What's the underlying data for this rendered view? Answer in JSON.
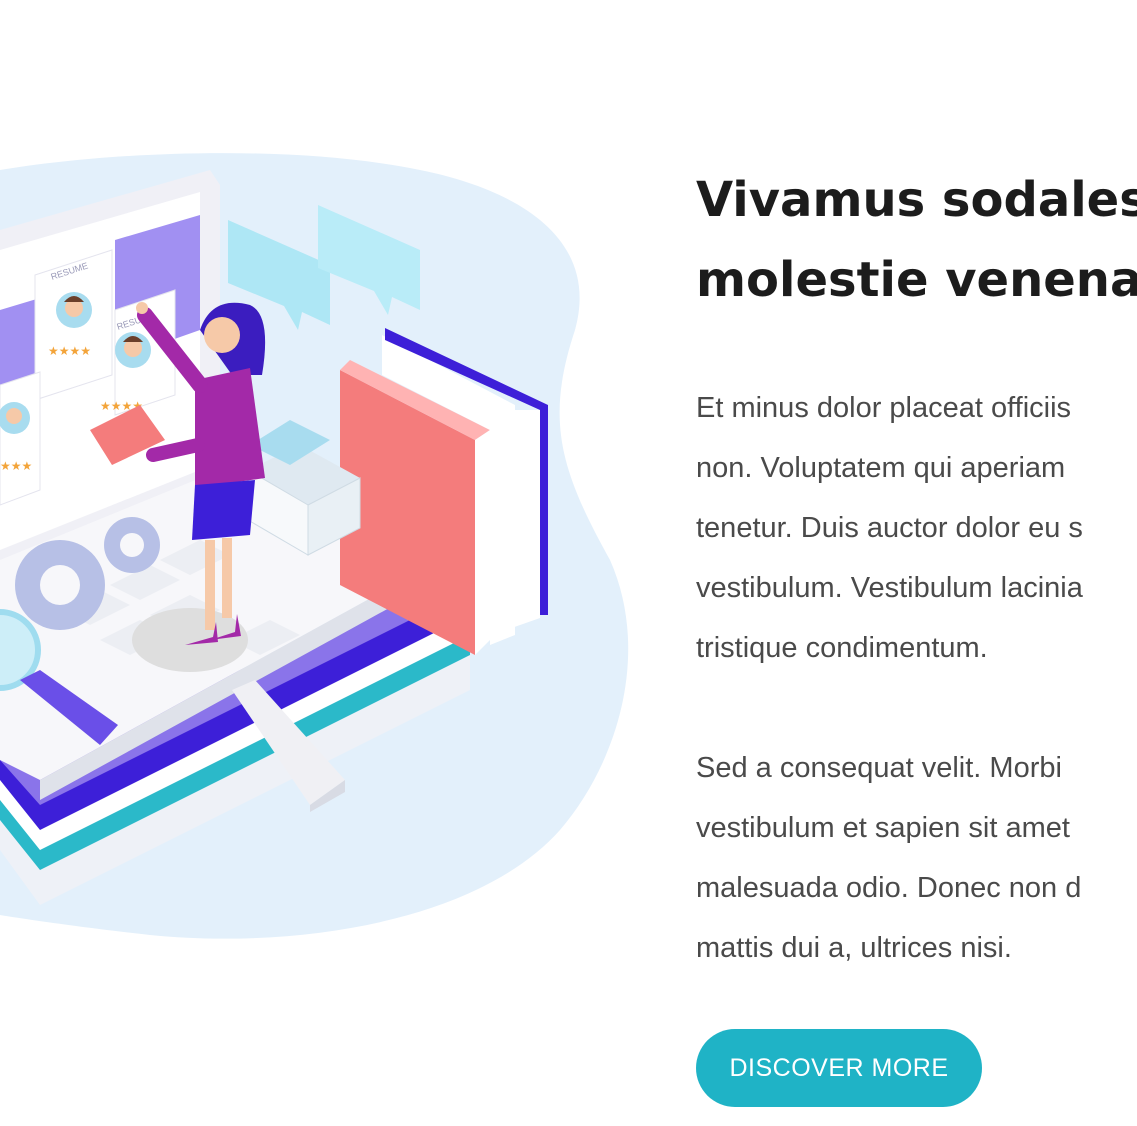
{
  "illustration": {
    "resume_label": "RESUME",
    "colors": {
      "blob": "#e3f0fb",
      "purple": "#8a74ea",
      "indigo": "#3d1fd8",
      "teal": "#2bb9c9",
      "coral": "#f47c7c",
      "magenta": "#a329a8"
    }
  },
  "hero": {
    "heading_lines": [
      "Vivamus sodales m",
      "molestie venenatis"
    ],
    "paragraph1_lines": [
      "Et minus dolor placeat officiis",
      "non. Voluptatem qui aperiam",
      "tenetur. Duis auctor dolor eu s",
      "vestibulum. Vestibulum lacinia",
      "tristique condimentum."
    ],
    "paragraph2_lines": [
      "Sed a consequat velit. Morbi",
      "vestibulum et sapien sit amet",
      "malesuada odio. Donec non d",
      "mattis dui a, ultrices nisi."
    ],
    "cta_label": "DISCOVER MORE"
  }
}
